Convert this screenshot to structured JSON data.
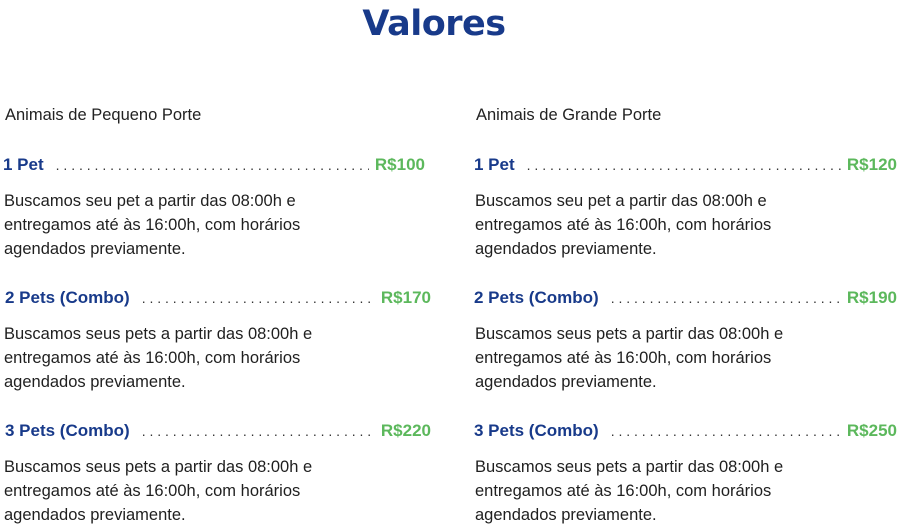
{
  "title": "Valores",
  "columns": [
    {
      "category": "Animais de Pequeno Porte",
      "items": [
        {
          "name": "1 Pet",
          "price": "R$100",
          "description": "Buscamos seu pet a partir das 08:00h e entregamos até às 16:00h, com horários agendados previamente."
        },
        {
          "name": "2 Pets (Combo)",
          "price": "R$170",
          "description": "Buscamos seus pets a partir das 08:00h e entregamos até às 16:00h, com horários agendados previamente."
        },
        {
          "name": "3 Pets (Combo)",
          "price": "R$220",
          "description": "Buscamos seus pets a partir das 08:00h e entregamos até às 16:00h, com horários agendados previamente."
        }
      ]
    },
    {
      "category": "Animais de Grande Porte",
      "items": [
        {
          "name": "1 Pet",
          "price": "R$120",
          "description": "Buscamos seu pet a partir das 08:00h e entregamos até às 16:00h, com horários agendados previamente."
        },
        {
          "name": "2 Pets (Combo)",
          "price": "R$190",
          "description": "Buscamos seus pets a partir das 08:00h e entregamos até às 16:00h, com horários agendados previamente."
        },
        {
          "name": "3 Pets (Combo)",
          "price": "R$250",
          "description": "Buscamos seus pets a partir das 08:00h e entregamos até às 16:00h, com horários agendados previamente."
        }
      ]
    }
  ],
  "colors": {
    "title": "#183a8a",
    "item_name": "#183a8a",
    "price": "#5cb85c",
    "text": "#1f1f1f"
  }
}
